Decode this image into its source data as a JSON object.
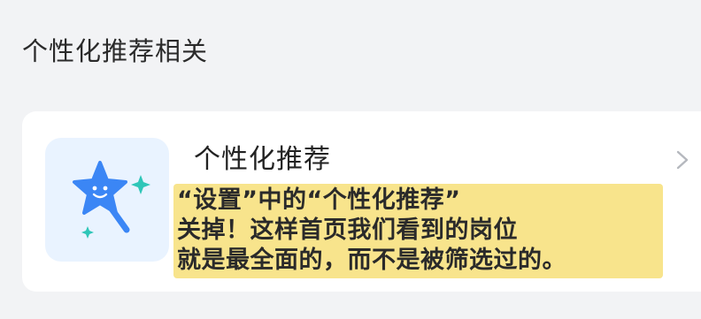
{
  "section": {
    "title": "个性化推荐相关"
  },
  "setting_item": {
    "title": "个性化推荐",
    "icon": "magic-wand-star-icon",
    "chevron": "chevron-right-icon"
  },
  "annotation": {
    "lines": [
      "“设置”中的“个性化推荐”",
      "关掉！这样首页我们看到的岗位",
      "就是最全面的，而不是被筛选过的。"
    ],
    "background_color": "#f8e48c"
  },
  "colors": {
    "page_bg": "#f2f3f5",
    "card_bg": "#ffffff",
    "icon_tile_bg": "#e9f3ff",
    "icon_blue": "#3b86f5",
    "sparkle_teal": "#2fc6b8"
  }
}
